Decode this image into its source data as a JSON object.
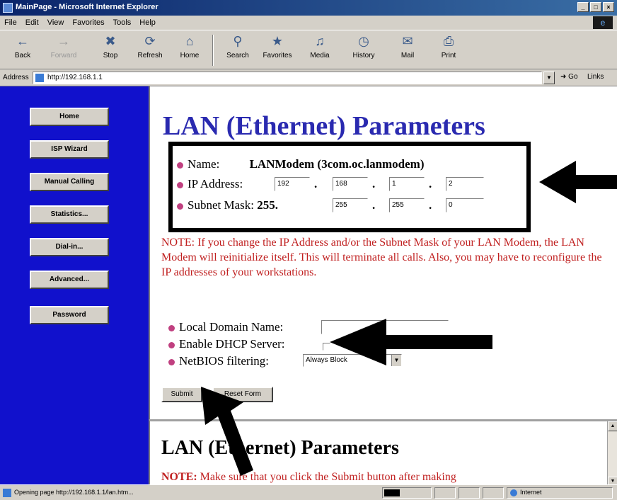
{
  "window": {
    "title": "MainPage - Microsoft Internet Explorer"
  },
  "menu": [
    "File",
    "Edit",
    "View",
    "Favorites",
    "Tools",
    "Help"
  ],
  "toolbar": [
    {
      "label": "Back",
      "icon": "back-arrow-icon"
    },
    {
      "label": "Forward",
      "icon": "forward-arrow-icon"
    },
    {
      "label": "Stop",
      "icon": "stop-icon"
    },
    {
      "label": "Refresh",
      "icon": "refresh-icon"
    },
    {
      "label": "Home",
      "icon": "home-icon"
    },
    {
      "label": "Search",
      "icon": "search-icon"
    },
    {
      "label": "Favorites",
      "icon": "favorites-icon"
    },
    {
      "label": "Media",
      "icon": "media-icon"
    },
    {
      "label": "History",
      "icon": "history-icon"
    },
    {
      "label": "Mail",
      "icon": "mail-icon"
    },
    {
      "label": "Print",
      "icon": "print-icon"
    }
  ],
  "address": {
    "label": "Address",
    "url": "http://192.168.1.1",
    "go": "Go",
    "links": "Links"
  },
  "sidebar": [
    "Home",
    "ISP Wizard",
    "Manual Calling",
    "Statistics...",
    "Dial-in...",
    "Advanced...",
    "Password"
  ],
  "main": {
    "title": "LAN (Ethernet) Parameters",
    "name_label": "Name:",
    "name_value": "LANModem (3com.oc.lanmodem)",
    "ip_label": "IP Address:",
    "ip": [
      "192",
      "168",
      "1",
      "2"
    ],
    "mask_label": "Subnet Mask:",
    "mask_first": "255.",
    "mask": [
      "255",
      "255",
      "0"
    ],
    "note": "NOTE: If you change the IP Address and/or the Subnet Mask of your LAN Modem, the LAN Modem will reinitialize itself. This will terminate all calls. Also, you may have to reconfigure the IP addresses of your workstations.",
    "domain_label": "Local Domain Name:",
    "domain_value": "",
    "dhcp_label": "Enable DHCP Server:",
    "dhcp_checked": false,
    "netbios_label": "NetBIOS filtering:",
    "netbios_value": "Always Block",
    "submit": "Submit",
    "reset": "Reset Form"
  },
  "help": {
    "title": "LAN (Ethernet) Parameters",
    "note_prefix": "NOTE:",
    "note_text": "Make sure that you click the Submit button after making"
  },
  "status": {
    "text": "Opening page http://192.168.1.1/lan.htm...",
    "progress": 0.35,
    "zone": "Internet"
  }
}
